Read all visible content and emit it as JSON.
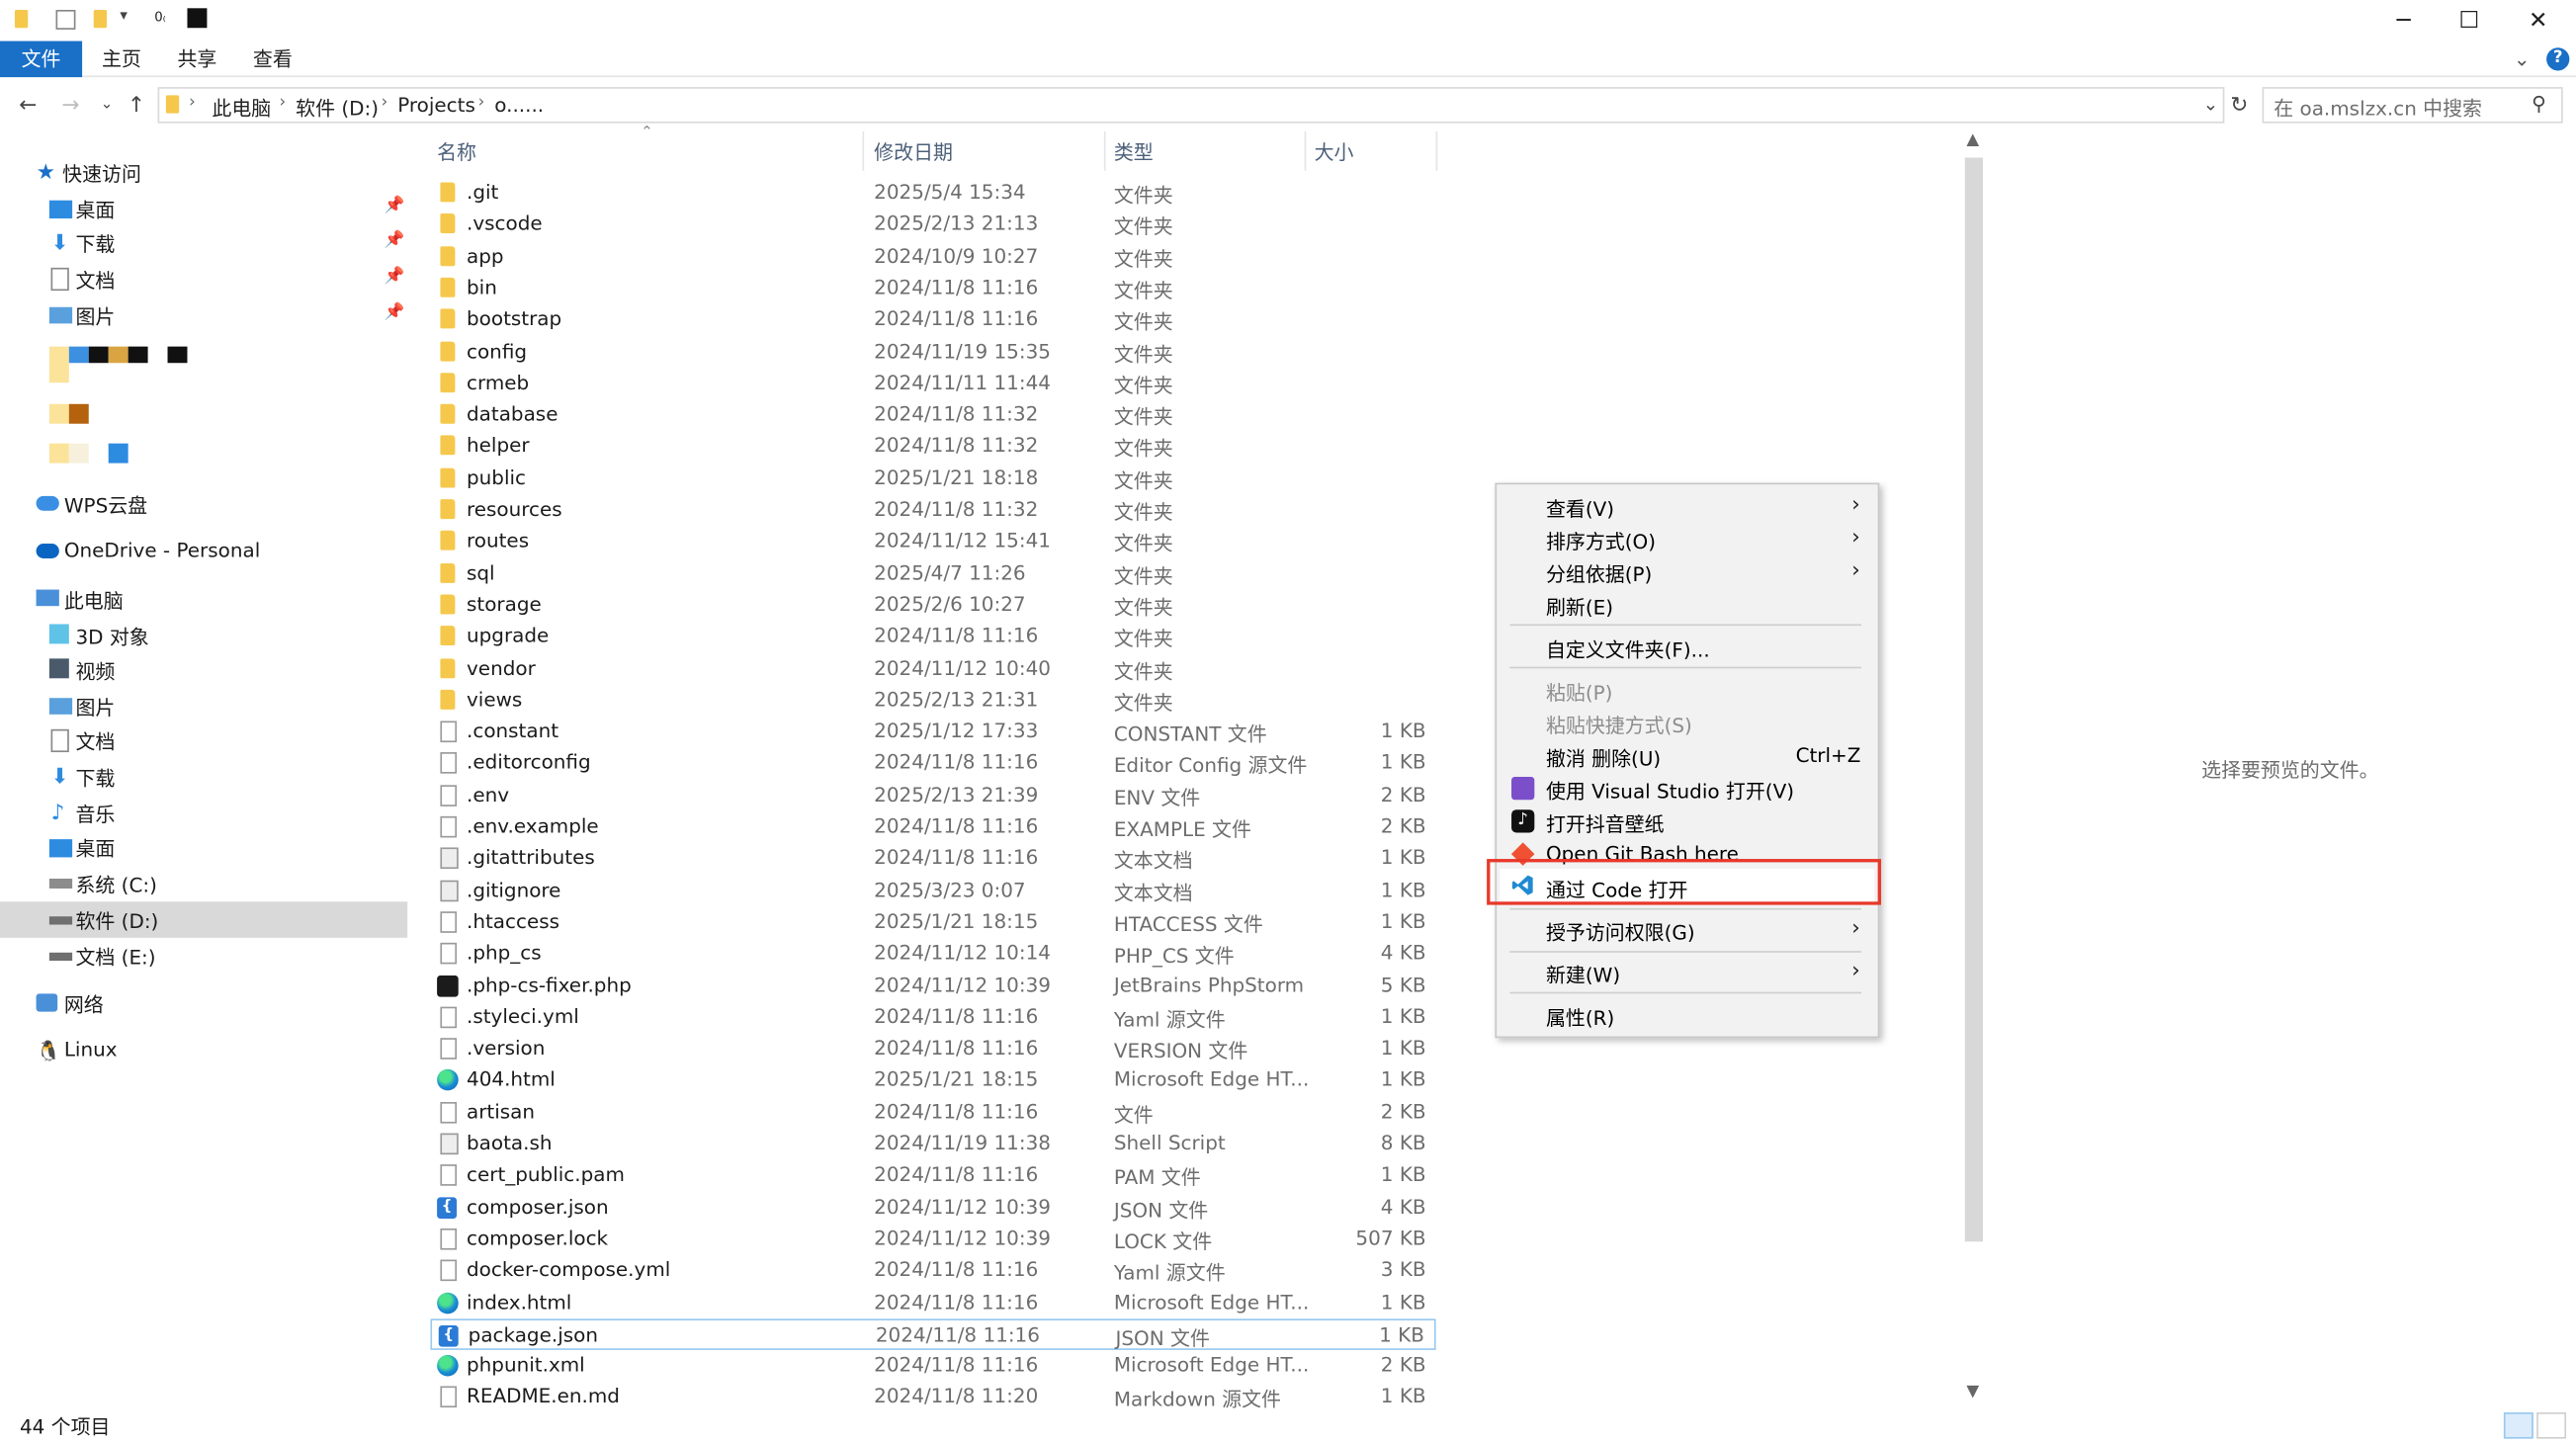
{
  "ribbon": {
    "tabs": [
      "文件",
      "主页",
      "共享",
      "查看"
    ]
  },
  "address": {
    "crumbs": [
      "此电脑",
      "软件 (D:)",
      "Projects",
      "o......"
    ],
    "search_placeholder": "在 oa.mslzx.cn 中搜索"
  },
  "navpane": {
    "quick_access": "快速访问",
    "pinned": [
      "桌面",
      "下载",
      "文档",
      "图片"
    ],
    "wps": "WPS云盘",
    "onedrive": "OneDrive - Personal",
    "this_pc": "此电脑",
    "pc_items": [
      "3D 对象",
      "视频",
      "图片",
      "文档",
      "下载",
      "音乐",
      "桌面",
      "系统 (C:)",
      "软件 (D:)",
      "文档 (E:)"
    ],
    "network": "网络",
    "linux": "Linux"
  },
  "columns": {
    "name": "名称",
    "date": "修改日期",
    "type": "类型",
    "size": "大小"
  },
  "files": [
    {
      "name": ".git",
      "date": "2025/5/4 15:34",
      "type": "文件夹",
      "size": "",
      "icon": "folder"
    },
    {
      "name": ".vscode",
      "date": "2025/2/13 21:13",
      "type": "文件夹",
      "size": "",
      "icon": "folder"
    },
    {
      "name": "app",
      "date": "2024/10/9 10:27",
      "type": "文件夹",
      "size": "",
      "icon": "folder"
    },
    {
      "name": "bin",
      "date": "2024/11/8 11:16",
      "type": "文件夹",
      "size": "",
      "icon": "folder"
    },
    {
      "name": "bootstrap",
      "date": "2024/11/8 11:16",
      "type": "文件夹",
      "size": "",
      "icon": "folder"
    },
    {
      "name": "config",
      "date": "2024/11/19 15:35",
      "type": "文件夹",
      "size": "",
      "icon": "folder"
    },
    {
      "name": "crmeb",
      "date": "2024/11/11 11:44",
      "type": "文件夹",
      "size": "",
      "icon": "folder"
    },
    {
      "name": "database",
      "date": "2024/11/8 11:32",
      "type": "文件夹",
      "size": "",
      "icon": "folder"
    },
    {
      "name": "helper",
      "date": "2024/11/8 11:32",
      "type": "文件夹",
      "size": "",
      "icon": "folder"
    },
    {
      "name": "public",
      "date": "2025/1/21 18:18",
      "type": "文件夹",
      "size": "",
      "icon": "folder"
    },
    {
      "name": "resources",
      "date": "2024/11/8 11:32",
      "type": "文件夹",
      "size": "",
      "icon": "folder"
    },
    {
      "name": "routes",
      "date": "2024/11/12 15:41",
      "type": "文件夹",
      "size": "",
      "icon": "folder"
    },
    {
      "name": "sql",
      "date": "2025/4/7 11:26",
      "type": "文件夹",
      "size": "",
      "icon": "folder"
    },
    {
      "name": "storage",
      "date": "2025/2/6 10:27",
      "type": "文件夹",
      "size": "",
      "icon": "folder"
    },
    {
      "name": "upgrade",
      "date": "2024/11/8 11:16",
      "type": "文件夹",
      "size": "",
      "icon": "folder"
    },
    {
      "name": "vendor",
      "date": "2024/11/12 10:40",
      "type": "文件夹",
      "size": "",
      "icon": "folder"
    },
    {
      "name": "views",
      "date": "2025/2/13 21:31",
      "type": "文件夹",
      "size": "",
      "icon": "folder"
    },
    {
      "name": ".constant",
      "date": "2025/1/12 17:33",
      "type": "CONSTANT 文件",
      "size": "1 KB",
      "icon": "doc"
    },
    {
      "name": ".editorconfig",
      "date": "2024/11/8 11:16",
      "type": "Editor Config 源文件",
      "size": "1 KB",
      "icon": "gear"
    },
    {
      "name": ".env",
      "date": "2025/2/13 21:39",
      "type": "ENV 文件",
      "size": "2 KB",
      "icon": "doc"
    },
    {
      "name": ".env.example",
      "date": "2024/11/8 11:16",
      "type": "EXAMPLE 文件",
      "size": "2 KB",
      "icon": "doc"
    },
    {
      "name": ".gitattributes",
      "date": "2024/11/8 11:16",
      "type": "文本文档",
      "size": "1 KB",
      "icon": "script"
    },
    {
      "name": ".gitignore",
      "date": "2025/3/23 0:07",
      "type": "文本文档",
      "size": "1 KB",
      "icon": "script"
    },
    {
      "name": ".htaccess",
      "date": "2025/1/21 18:15",
      "type": "HTACCESS 文件",
      "size": "1 KB",
      "icon": "doc"
    },
    {
      "name": ".php_cs",
      "date": "2024/11/12 10:14",
      "type": "PHP_CS 文件",
      "size": "4 KB",
      "icon": "doc"
    },
    {
      "name": ".php-cs-fixer.php",
      "date": "2024/11/12 10:39",
      "type": "JetBrains PhpStorm",
      "size": "5 KB",
      "icon": "php"
    },
    {
      "name": ".styleci.yml",
      "date": "2024/11/8 11:16",
      "type": "Yaml 源文件",
      "size": "1 KB",
      "icon": "doc"
    },
    {
      "name": ".version",
      "date": "2024/11/8 11:16",
      "type": "VERSION 文件",
      "size": "1 KB",
      "icon": "doc"
    },
    {
      "name": "404.html",
      "date": "2025/1/21 18:15",
      "type": "Microsoft Edge HT...",
      "size": "1 KB",
      "icon": "edge"
    },
    {
      "name": "artisan",
      "date": "2024/11/8 11:16",
      "type": "文件",
      "size": "2 KB",
      "icon": "doc"
    },
    {
      "name": "baota.sh",
      "date": "2024/11/19 11:38",
      "type": "Shell Script",
      "size": "8 KB",
      "icon": "script"
    },
    {
      "name": "cert_public.pam",
      "date": "2024/11/8 11:16",
      "type": "PAM 文件",
      "size": "1 KB",
      "icon": "doc"
    },
    {
      "name": "composer.json",
      "date": "2024/11/12 10:39",
      "type": "JSON 文件",
      "size": "4 KB",
      "icon": "json"
    },
    {
      "name": "composer.lock",
      "date": "2024/11/12 10:39",
      "type": "LOCK 文件",
      "size": "507 KB",
      "icon": "doc"
    },
    {
      "name": "docker-compose.yml",
      "date": "2024/11/8 11:16",
      "type": "Yaml 源文件",
      "size": "3 KB",
      "icon": "doc"
    },
    {
      "name": "index.html",
      "date": "2024/11/8 11:16",
      "type": "Microsoft Edge HT...",
      "size": "1 KB",
      "icon": "edge"
    },
    {
      "name": "package.json",
      "date": "2024/11/8 11:16",
      "type": "JSON 文件",
      "size": "1 KB",
      "icon": "json",
      "selected": true
    },
    {
      "name": "phpunit.xml",
      "date": "2024/11/8 11:16",
      "type": "Microsoft Edge HT...",
      "size": "2 KB",
      "icon": "edge"
    },
    {
      "name": "README.en.md",
      "date": "2024/11/8 11:20",
      "type": "Markdown 源文件",
      "size": "1 KB",
      "icon": "doc"
    }
  ],
  "preview_text": "选择要预览的文件。",
  "context_menu": {
    "view": "查看(V)",
    "sort": "排序方式(O)",
    "group": "分组依据(P)",
    "refresh": "刷新(E)",
    "customize": "自定义文件夹(F)...",
    "paste": "粘贴(P)",
    "paste_shortcut": "粘贴快捷方式(S)",
    "undo": "撤消 删除(U)",
    "undo_shortcut": "Ctrl+Z",
    "open_vs": "使用 Visual Studio 打开(V)",
    "open_douyin": "打开抖音壁纸",
    "git_bash": "Open Git Bash here",
    "open_code": "通过 Code 打开",
    "grant_access": "授予访问权限(G)",
    "new": "新建(W)",
    "properties": "属性(R)"
  },
  "status": {
    "count": "44 个项目"
  },
  "colors": {
    "accent": "#1a6fc7",
    "highlight": "#e8392a",
    "folder": "#f5c84c"
  }
}
